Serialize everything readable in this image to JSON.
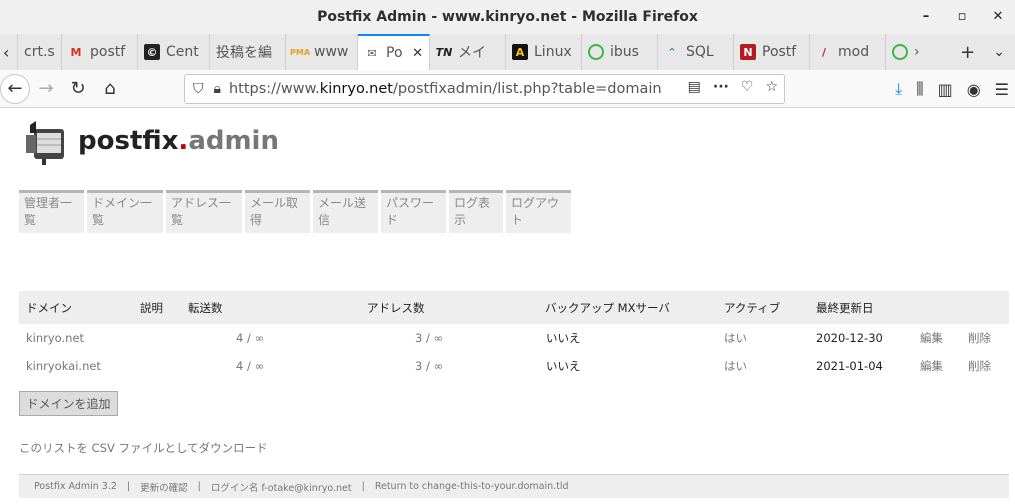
{
  "window": {
    "title": "Postfix Admin - www.kinryo.net - Mozilla Firefox"
  },
  "tabs": [
    {
      "label": "crt.sh",
      "icon": "blank-icon"
    },
    {
      "label": "postf",
      "icon": "gmail-icon"
    },
    {
      "label": "Cent",
      "icon": "centos-icon"
    },
    {
      "label": "投稿を編",
      "icon": "blank-icon"
    },
    {
      "label": "www",
      "icon": "pma-icon"
    },
    {
      "label": "Po",
      "icon": "postfix-icon",
      "active": true
    },
    {
      "label": "メイ",
      "icon": "tn-icon"
    },
    {
      "label": "Linux",
      "icon": "linux-icon"
    },
    {
      "label": "ibus",
      "icon": "green-q-icon"
    },
    {
      "label": "SQL",
      "icon": "sql-icon"
    },
    {
      "label": "Postf",
      "icon": "red-n-icon"
    },
    {
      "label": "mod",
      "icon": "slash-icon"
    }
  ],
  "address_bar": {
    "url_prefix": "https://www.",
    "url_domain": "kinryo.net",
    "url_suffix": "/postfixadmin/list.php?table=domain"
  },
  "logo": {
    "part1": "postfix",
    "dot": ".",
    "part2": "admin"
  },
  "menu": [
    "管理者一覧",
    "ドメイン一覧",
    "アドレス一覧",
    "メール取得",
    "メール送信",
    "パスワード",
    "ログ表示",
    "ログアウト"
  ],
  "table": {
    "headers": {
      "domain": "ドメイン",
      "description": "説明",
      "aliases": "転送数",
      "mailboxes": "アドレス数",
      "backup_mx": "バックアップ MXサーバ",
      "active": "アクティブ",
      "modified": "最終更新日"
    },
    "rows": [
      {
        "domain": "kinryo.net",
        "aliases": "4 / ∞",
        "mailboxes": "3 / ∞",
        "backup_mx": "いいえ",
        "active": "はい",
        "modified": "2020-12-30",
        "edit": "編集",
        "delete": "削除"
      },
      {
        "domain": "kinryokai.net",
        "aliases": "4 / ∞",
        "mailboxes": "3 / ∞",
        "backup_mx": "いいえ",
        "active": "はい",
        "modified": "2021-01-04",
        "edit": "編集",
        "delete": "削除"
      }
    ]
  },
  "add_button": "ドメインを追加",
  "csv_link": "このリストを CSV ファイルとしてダウンロード",
  "footer": {
    "version": "Postfix Admin 3.2",
    "sep1": "|",
    "check_updates": "更新の確認",
    "sep2": "|",
    "login": "ログイン名 f-otake@kinryo.net",
    "sep3": "|",
    "return": "Return to change-this-to-your.domain.tld"
  }
}
